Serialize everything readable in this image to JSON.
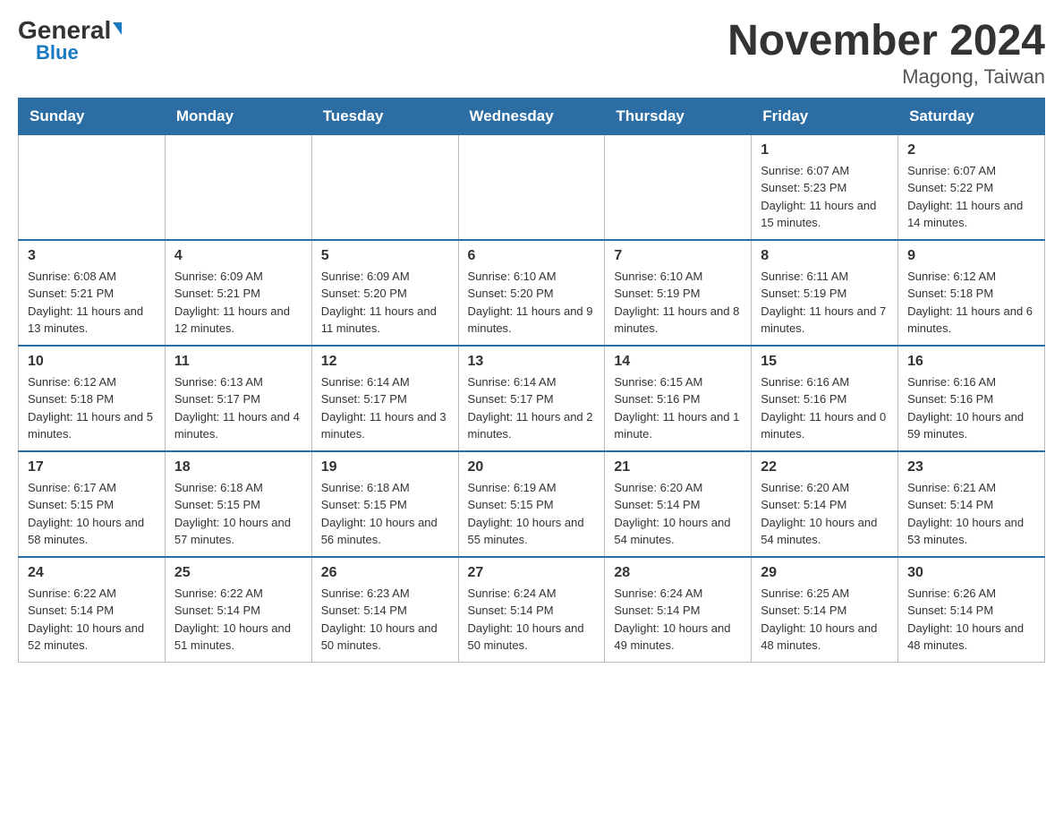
{
  "header": {
    "logo_general": "General",
    "logo_blue": "Blue",
    "title": "November 2024",
    "subtitle": "Magong, Taiwan"
  },
  "days_of_week": [
    "Sunday",
    "Monday",
    "Tuesday",
    "Wednesday",
    "Thursday",
    "Friday",
    "Saturday"
  ],
  "weeks": [
    {
      "days": [
        {
          "number": "",
          "info": ""
        },
        {
          "number": "",
          "info": ""
        },
        {
          "number": "",
          "info": ""
        },
        {
          "number": "",
          "info": ""
        },
        {
          "number": "",
          "info": ""
        },
        {
          "number": "1",
          "info": "Sunrise: 6:07 AM\nSunset: 5:23 PM\nDaylight: 11 hours and 15 minutes."
        },
        {
          "number": "2",
          "info": "Sunrise: 6:07 AM\nSunset: 5:22 PM\nDaylight: 11 hours and 14 minutes."
        }
      ]
    },
    {
      "days": [
        {
          "number": "3",
          "info": "Sunrise: 6:08 AM\nSunset: 5:21 PM\nDaylight: 11 hours and 13 minutes."
        },
        {
          "number": "4",
          "info": "Sunrise: 6:09 AM\nSunset: 5:21 PM\nDaylight: 11 hours and 12 minutes."
        },
        {
          "number": "5",
          "info": "Sunrise: 6:09 AM\nSunset: 5:20 PM\nDaylight: 11 hours and 11 minutes."
        },
        {
          "number": "6",
          "info": "Sunrise: 6:10 AM\nSunset: 5:20 PM\nDaylight: 11 hours and 9 minutes."
        },
        {
          "number": "7",
          "info": "Sunrise: 6:10 AM\nSunset: 5:19 PM\nDaylight: 11 hours and 8 minutes."
        },
        {
          "number": "8",
          "info": "Sunrise: 6:11 AM\nSunset: 5:19 PM\nDaylight: 11 hours and 7 minutes."
        },
        {
          "number": "9",
          "info": "Sunrise: 6:12 AM\nSunset: 5:18 PM\nDaylight: 11 hours and 6 minutes."
        }
      ]
    },
    {
      "days": [
        {
          "number": "10",
          "info": "Sunrise: 6:12 AM\nSunset: 5:18 PM\nDaylight: 11 hours and 5 minutes."
        },
        {
          "number": "11",
          "info": "Sunrise: 6:13 AM\nSunset: 5:17 PM\nDaylight: 11 hours and 4 minutes."
        },
        {
          "number": "12",
          "info": "Sunrise: 6:14 AM\nSunset: 5:17 PM\nDaylight: 11 hours and 3 minutes."
        },
        {
          "number": "13",
          "info": "Sunrise: 6:14 AM\nSunset: 5:17 PM\nDaylight: 11 hours and 2 minutes."
        },
        {
          "number": "14",
          "info": "Sunrise: 6:15 AM\nSunset: 5:16 PM\nDaylight: 11 hours and 1 minute."
        },
        {
          "number": "15",
          "info": "Sunrise: 6:16 AM\nSunset: 5:16 PM\nDaylight: 11 hours and 0 minutes."
        },
        {
          "number": "16",
          "info": "Sunrise: 6:16 AM\nSunset: 5:16 PM\nDaylight: 10 hours and 59 minutes."
        }
      ]
    },
    {
      "days": [
        {
          "number": "17",
          "info": "Sunrise: 6:17 AM\nSunset: 5:15 PM\nDaylight: 10 hours and 58 minutes."
        },
        {
          "number": "18",
          "info": "Sunrise: 6:18 AM\nSunset: 5:15 PM\nDaylight: 10 hours and 57 minutes."
        },
        {
          "number": "19",
          "info": "Sunrise: 6:18 AM\nSunset: 5:15 PM\nDaylight: 10 hours and 56 minutes."
        },
        {
          "number": "20",
          "info": "Sunrise: 6:19 AM\nSunset: 5:15 PM\nDaylight: 10 hours and 55 minutes."
        },
        {
          "number": "21",
          "info": "Sunrise: 6:20 AM\nSunset: 5:14 PM\nDaylight: 10 hours and 54 minutes."
        },
        {
          "number": "22",
          "info": "Sunrise: 6:20 AM\nSunset: 5:14 PM\nDaylight: 10 hours and 54 minutes."
        },
        {
          "number": "23",
          "info": "Sunrise: 6:21 AM\nSunset: 5:14 PM\nDaylight: 10 hours and 53 minutes."
        }
      ]
    },
    {
      "days": [
        {
          "number": "24",
          "info": "Sunrise: 6:22 AM\nSunset: 5:14 PM\nDaylight: 10 hours and 52 minutes."
        },
        {
          "number": "25",
          "info": "Sunrise: 6:22 AM\nSunset: 5:14 PM\nDaylight: 10 hours and 51 minutes."
        },
        {
          "number": "26",
          "info": "Sunrise: 6:23 AM\nSunset: 5:14 PM\nDaylight: 10 hours and 50 minutes."
        },
        {
          "number": "27",
          "info": "Sunrise: 6:24 AM\nSunset: 5:14 PM\nDaylight: 10 hours and 50 minutes."
        },
        {
          "number": "28",
          "info": "Sunrise: 6:24 AM\nSunset: 5:14 PM\nDaylight: 10 hours and 49 minutes."
        },
        {
          "number": "29",
          "info": "Sunrise: 6:25 AM\nSunset: 5:14 PM\nDaylight: 10 hours and 48 minutes."
        },
        {
          "number": "30",
          "info": "Sunrise: 6:26 AM\nSunset: 5:14 PM\nDaylight: 10 hours and 48 minutes."
        }
      ]
    }
  ]
}
